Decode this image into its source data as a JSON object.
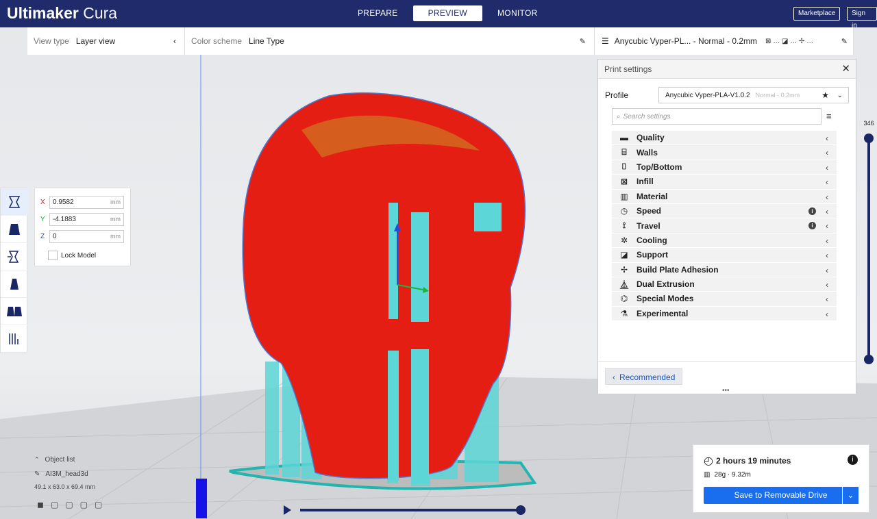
{
  "app": {
    "brand_bold": "Ultimaker",
    "brand_thin": " Cura"
  },
  "stages": [
    "PREPARE",
    "PREVIEW",
    "MONITOR"
  ],
  "header": {
    "marketplace": "Marketplace",
    "signin": "Sign in"
  },
  "toolbar": {
    "view_type_label": "View type",
    "view_type_value": "Layer view",
    "color_scheme_label": "Color scheme",
    "color_scheme_value": "Line Type",
    "printer_summary": "Anycubic Vyper-PL... - Normal - 0.2mm"
  },
  "move": {
    "x_label": "X",
    "x": "0.9582",
    "y_label": "Y",
    "y": "-4.1883",
    "z_label": "Z",
    "z": "0",
    "unit": "mm",
    "lock_label": "Lock Model"
  },
  "print_settings": {
    "title": "Print settings",
    "profile_label": "Profile",
    "profile_value": "Anycubic Vyper-PLA-V1.0.2",
    "profile_sub": "Normal - 0.2mm",
    "search_placeholder": "Search settings",
    "categories": [
      "Quality",
      "Walls",
      "Top/Bottom",
      "Infill",
      "Material",
      "Speed",
      "Travel",
      "Cooling",
      "Support",
      "Build Plate Adhesion",
      "Dual Extrusion",
      "Special Modes",
      "Experimental"
    ],
    "recommended": "Recommended"
  },
  "layer": {
    "max": "346"
  },
  "object_list": {
    "title": "Object list",
    "name": "AI3M_head3d",
    "dims": "49.1 x 63.0 x 69.4 mm"
  },
  "result": {
    "time": "2 hours 19 minutes",
    "material": "28g · 9.32m",
    "save": "Save to Removable Drive"
  },
  "colors": {
    "header": "#1f2b6b",
    "accent": "#196ef0",
    "shell": "#e41e12",
    "support": "#5cd6d6"
  }
}
